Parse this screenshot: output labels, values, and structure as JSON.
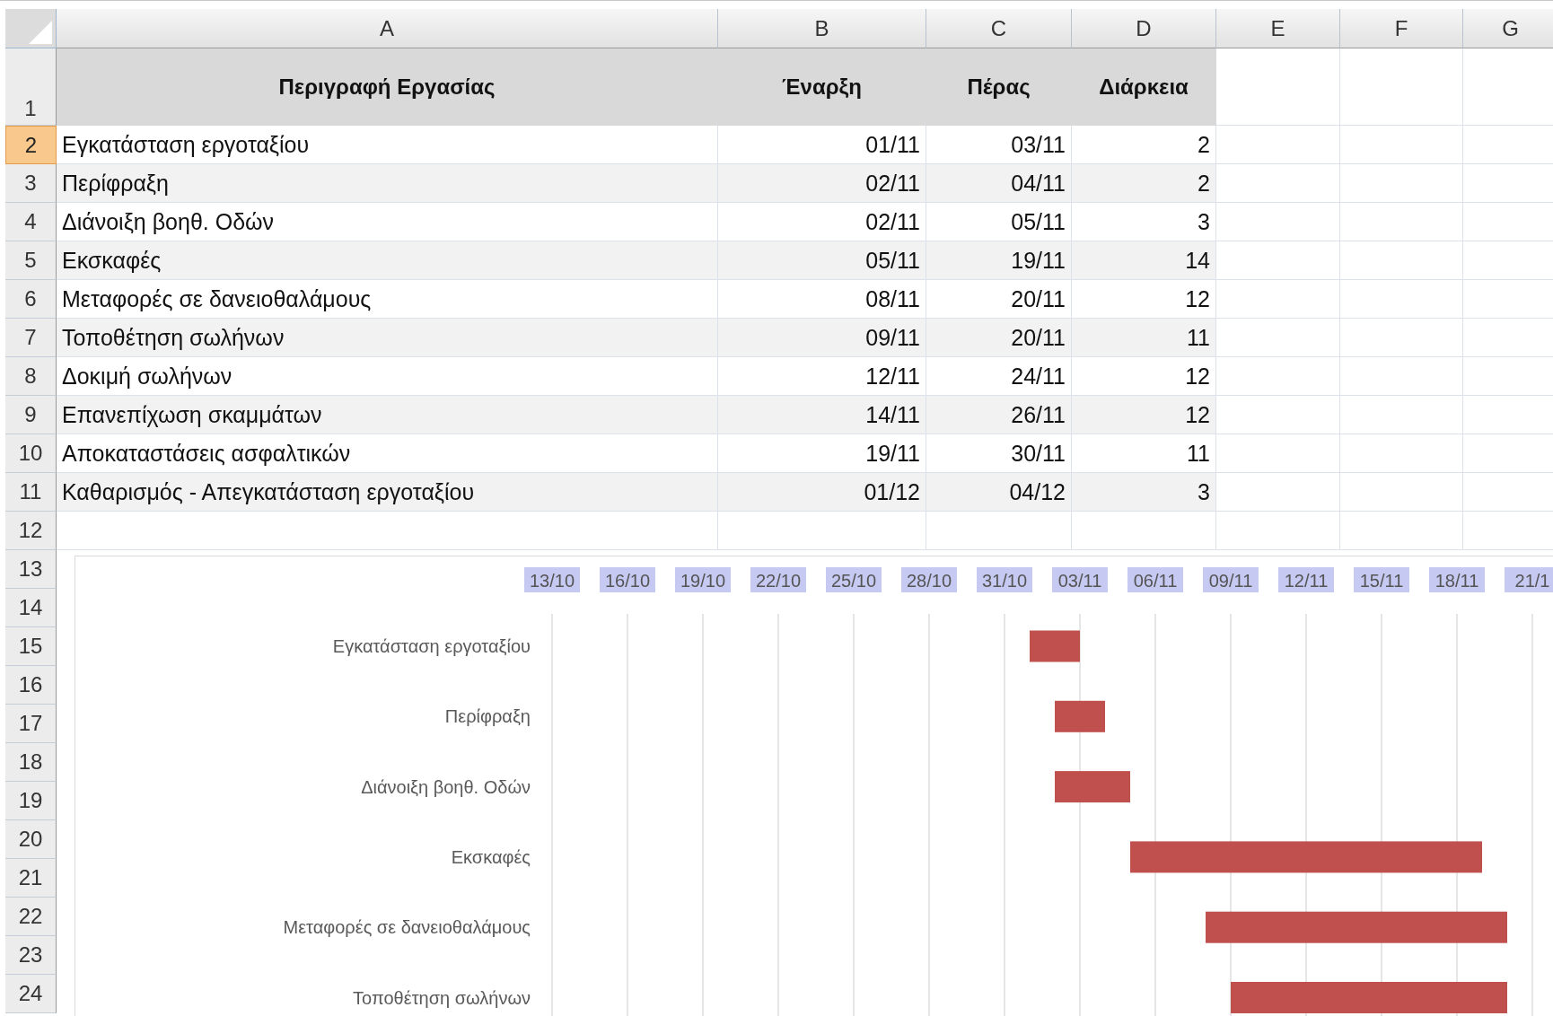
{
  "column_headers": [
    "A",
    "B",
    "C",
    "D",
    "E",
    "F",
    "G"
  ],
  "row_headers": [
    {
      "label": "1",
      "selected": false
    },
    {
      "label": "2",
      "selected": true
    },
    {
      "label": "3",
      "selected": false
    },
    {
      "label": "4",
      "selected": false
    },
    {
      "label": "5",
      "selected": false
    },
    {
      "label": "6",
      "selected": false
    },
    {
      "label": "7",
      "selected": false
    },
    {
      "label": "8",
      "selected": false
    },
    {
      "label": "9",
      "selected": false
    },
    {
      "label": "10",
      "selected": false
    },
    {
      "label": "11",
      "selected": false
    },
    {
      "label": "12",
      "selected": false
    },
    {
      "label": "13",
      "selected": false
    },
    {
      "label": "14",
      "selected": false
    },
    {
      "label": "15",
      "selected": false
    },
    {
      "label": "16",
      "selected": false
    },
    {
      "label": "17",
      "selected": false
    },
    {
      "label": "18",
      "selected": false
    },
    {
      "label": "19",
      "selected": false
    },
    {
      "label": "20",
      "selected": false
    },
    {
      "label": "21",
      "selected": false
    },
    {
      "label": "22",
      "selected": false
    },
    {
      "label": "23",
      "selected": false
    },
    {
      "label": "24",
      "selected": false
    }
  ],
  "table": {
    "columns": [
      "Περιγραφή Εργασίας",
      "Έναρξη",
      "Πέρας",
      "Διάρκεια"
    ],
    "rows": [
      [
        "Εγκατάσταση εργοταξίου",
        "01/11",
        "03/11",
        "2"
      ],
      [
        "Περίφραξη",
        "02/11",
        "04/11",
        "2"
      ],
      [
        "Διάνοιξη βοηθ. Οδών",
        "02/11",
        "05/11",
        "3"
      ],
      [
        "Εκσκαφές",
        "05/11",
        "19/11",
        "14"
      ],
      [
        "Μεταφορές σε δανειοθαλάμους",
        "08/11",
        "20/11",
        "12"
      ],
      [
        "Τοποθέτηση σωλήνων",
        "09/11",
        "20/11",
        "11"
      ],
      [
        "Δοκιμή σωλήνων",
        "12/11",
        "24/11",
        "12"
      ],
      [
        "Επανεπίχωση σκαμμάτων",
        "14/11",
        "26/11",
        "12"
      ],
      [
        "Αποκαταστάσεις ασφαλτικών",
        "19/11",
        "30/11",
        "11"
      ],
      [
        "Καθαρισμός - Απεγκατάσταση εργοταξίου",
        "01/12",
        "04/12",
        "3"
      ]
    ]
  },
  "gantt_chart": {
    "date_labels": [
      "13/10",
      "16/10",
      "19/10",
      "22/10",
      "25/10",
      "28/10",
      "31/10",
      "03/11",
      "06/11",
      "09/11",
      "12/11",
      "15/11",
      "18/11",
      "21/1"
    ],
    "task_labels": [
      "Εγκατάσταση εργοταξίου",
      "Περίφραξη",
      "Διάνοιξη βοηθ. Οδών",
      "Εκσκαφές",
      "Μεταφορές σε δανειοθαλάμους",
      "Τοποθέτηση σωλήνων"
    ]
  }
}
